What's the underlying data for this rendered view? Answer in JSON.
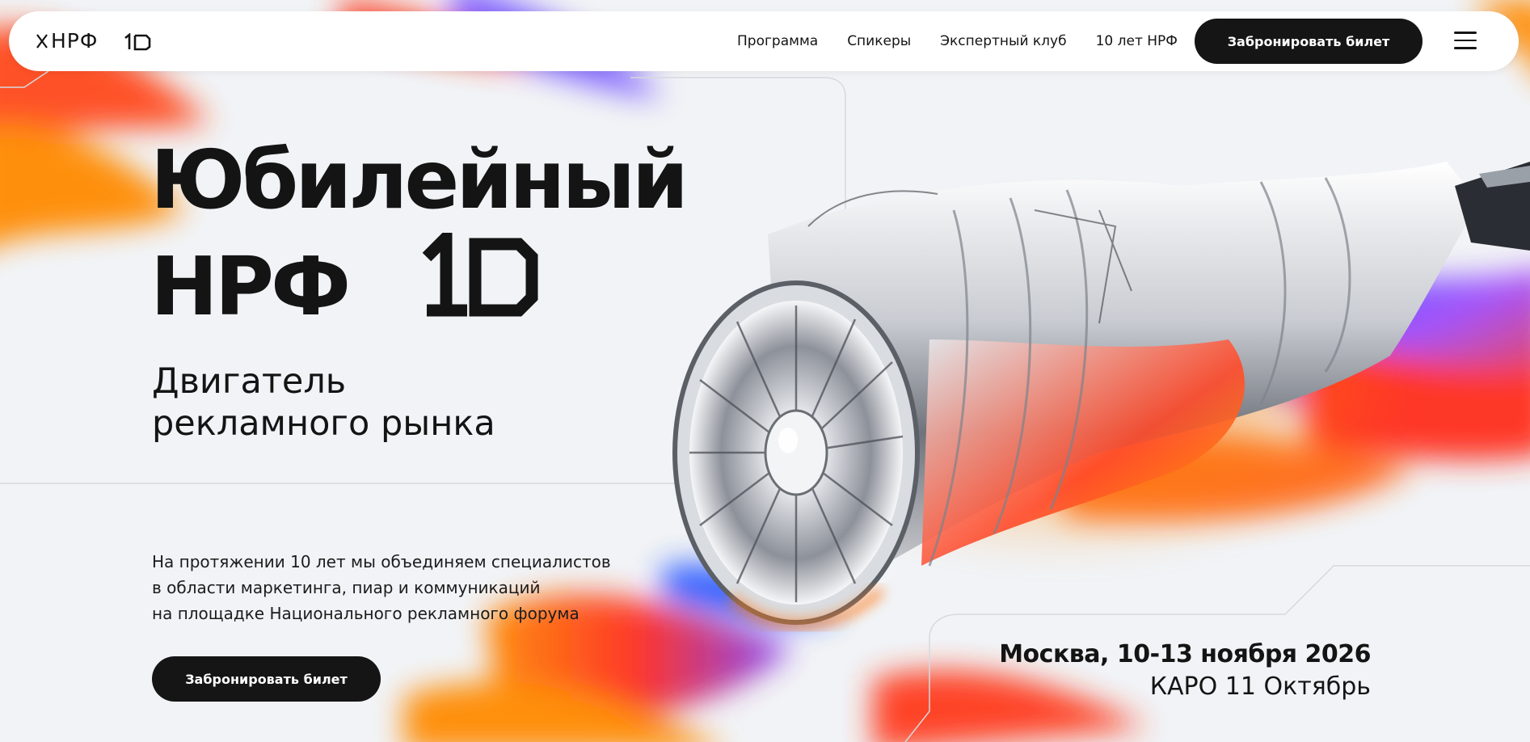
{
  "header": {
    "logo_text": "НРФ",
    "nav": [
      "Программа",
      "Спикеры",
      "Экспертный клуб",
      "10 лет НРФ"
    ],
    "cta_label": "Забронировать билет"
  },
  "hero": {
    "title_line1": "Юбилейный",
    "title_line2": "НРФ",
    "subtitle_lines": [
      "Двигатель",
      "рекламного рынка"
    ],
    "description_lines": [
      "На протяжении 10 лет мы объединяем специалистов",
      "в области маркетинга, пиар и коммуникаций",
      "на площадке Национального рекламного форума"
    ],
    "cta_label": "Забронировать билет",
    "event_date": "Москва, 10-13 ноября 2026",
    "event_venue": "КАРО 11 Октябрь"
  },
  "icons": {
    "logo_mark": "x-mark-icon",
    "logo_number": "ten-logo-icon",
    "menu": "burger-menu-icon",
    "illustration": "jet-engine-illustration"
  },
  "colors": {
    "background": "#f1f3f6",
    "dark": "#151515",
    "accent_red": "#ff3a1f",
    "accent_orange": "#ff8a00",
    "accent_blue": "#2f5dff",
    "accent_purple": "#8a4dff"
  }
}
